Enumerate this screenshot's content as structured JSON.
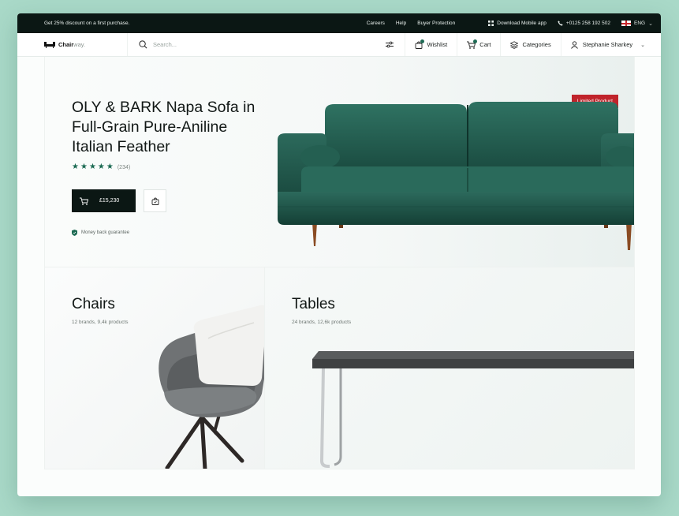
{
  "topbar": {
    "promo": "Get 25% discount on a first purchase.",
    "links": [
      "Careers",
      "Help",
      "Buyer Protection"
    ],
    "download": "Download Mobile app",
    "phone": "+0125 258 192 502",
    "language": "ENG"
  },
  "navbar": {
    "logo_bold": "Chair",
    "logo_light": "way.",
    "search_placeholder": "Search...",
    "wishlist": "Wishlist",
    "cart": "Cart",
    "categories": "Categories",
    "user": "Stephanie Sharkey"
  },
  "hero": {
    "title": "OLY & BARK Napa Sofa in Full-Grain Pure-Aniline Italian Feather",
    "rating_stars": 5,
    "rating_count": "(234)",
    "price": "£15,230",
    "guarantee": "Money back guarantee",
    "badge": "Limited Product"
  },
  "categories": [
    {
      "name": "Chairs",
      "meta": "12 brands, 9,4k products"
    },
    {
      "name": "Tables",
      "meta": "24 brands, 12,6k products"
    }
  ],
  "colors": {
    "background": "#a9d9c8",
    "dark": "#0b1714",
    "accent_green": "#1b6a52",
    "badge_red": "#c0242b",
    "sofa_green": "#1e5548"
  }
}
